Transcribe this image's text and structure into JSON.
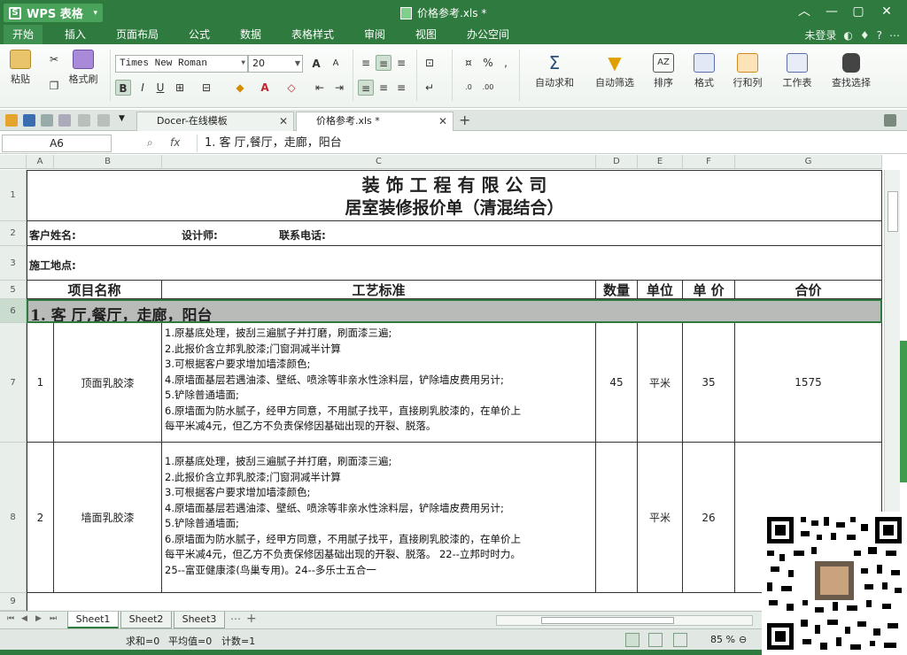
{
  "app": {
    "name": "WPS 表格",
    "doc_title": "价格参考.xls *"
  },
  "menu": {
    "tabs": [
      "开始",
      "插入",
      "页面布局",
      "公式",
      "数据",
      "表格样式",
      "审阅",
      "视图",
      "办公空间"
    ],
    "login": "未登录"
  },
  "ribbon": {
    "paste": "粘贴",
    "format_painter": "格式刷",
    "font_name": "Times New Roman",
    "font_size": "20",
    "autosum": "自动求和",
    "autofilter": "自动筛选",
    "sort": "排序",
    "format": "格式",
    "rows_cols": "行和列",
    "worksheet": "工作表",
    "find_select": "查找选择"
  },
  "doc_tabs": [
    {
      "label": "Docer-在线模板"
    },
    {
      "label": "价格参考.xls *"
    }
  ],
  "formula_bar": {
    "cell_ref": "A6",
    "fx": "fx",
    "content": "1. 客 厅,餐厅，走廊，阳台"
  },
  "columns": [
    "A",
    "B",
    "C",
    "D",
    "E",
    "F",
    "G"
  ],
  "sheet": {
    "company": "装 饰 工 程 有 限 公 司",
    "subtitle": "居室装修报价单（清混结合）",
    "client_label": "客户姓名:",
    "designer_label": "设计师:",
    "phone_label": "联系电话:",
    "site_label": "施工地点:",
    "headers": {
      "item": "项目名称",
      "process": "工艺标准",
      "qty": "数量",
      "unit": "单位",
      "price": "单 价",
      "total": "合价"
    },
    "section": "1. 客 厅,餐厅，走廊，阳台",
    "rows": [
      {
        "no": "1",
        "name": "顶面乳胶漆",
        "lines": [
          "1.原基底处理，披刮三遍腻子并打磨，刷面漆三遍;",
          "2.此报价含立邦乳胶漆;门窗洞减半计算",
          "3.可根据客户要求增加墙漆颜色;",
          "4.原墙面基层若遇油漆、壁纸、喷涂等非亲水性涂料层，铲除墙皮费用另计;",
          "5.铲除普通墙面;",
          "6.原墙面为防水腻子，经甲方同意，不用腻子找平，直接刷乳胶漆的，在单价上",
          "每平米减4元，但乙方不负责保修因基础出现的开裂、脱落。"
        ],
        "qty": "45",
        "unit": "平米",
        "price": "35",
        "total": "1575"
      },
      {
        "no": "2",
        "name": "墙面乳胶漆",
        "lines": [
          "1.原基底处理，披刮三遍腻子并打磨，刷面漆三遍;",
          "2.此报价含立邦乳胶漆;门窗洞减半计算",
          "3.可根据客户要求增加墙漆颜色;",
          "4.原墙面基层若遇油漆、壁纸、喷涂等非亲水性涂料层，铲除墙皮费用另计;",
          "5.铲除普通墙面;",
          "6.原墙面为防水腻子，经甲方同意，不用腻子找平，直接刷乳胶漆的，在单价上",
          "每平米减4元，但乙方不负责保修因基础出现的开裂、脱落。 22--立邦时时力。",
          "25--富亚健康漆(鸟巢专用)。24--多乐士五合一"
        ],
        "qty": "",
        "unit": "平米",
        "price": "26",
        "total": ""
      }
    ],
    "row_numbers": [
      "1",
      "2",
      "3",
      "5",
      "6",
      "7",
      "8",
      "9"
    ]
  },
  "sheet_tabs": [
    "Sheet1",
    "Sheet2",
    "Sheet3"
  ],
  "status": {
    "sum": "求和=0",
    "avg": "平均值=0",
    "count": "计数=1",
    "zoom": "85 %"
  },
  "colors": {
    "accent": "#2f7a3e",
    "selection_row": "#b9bbb9"
  }
}
